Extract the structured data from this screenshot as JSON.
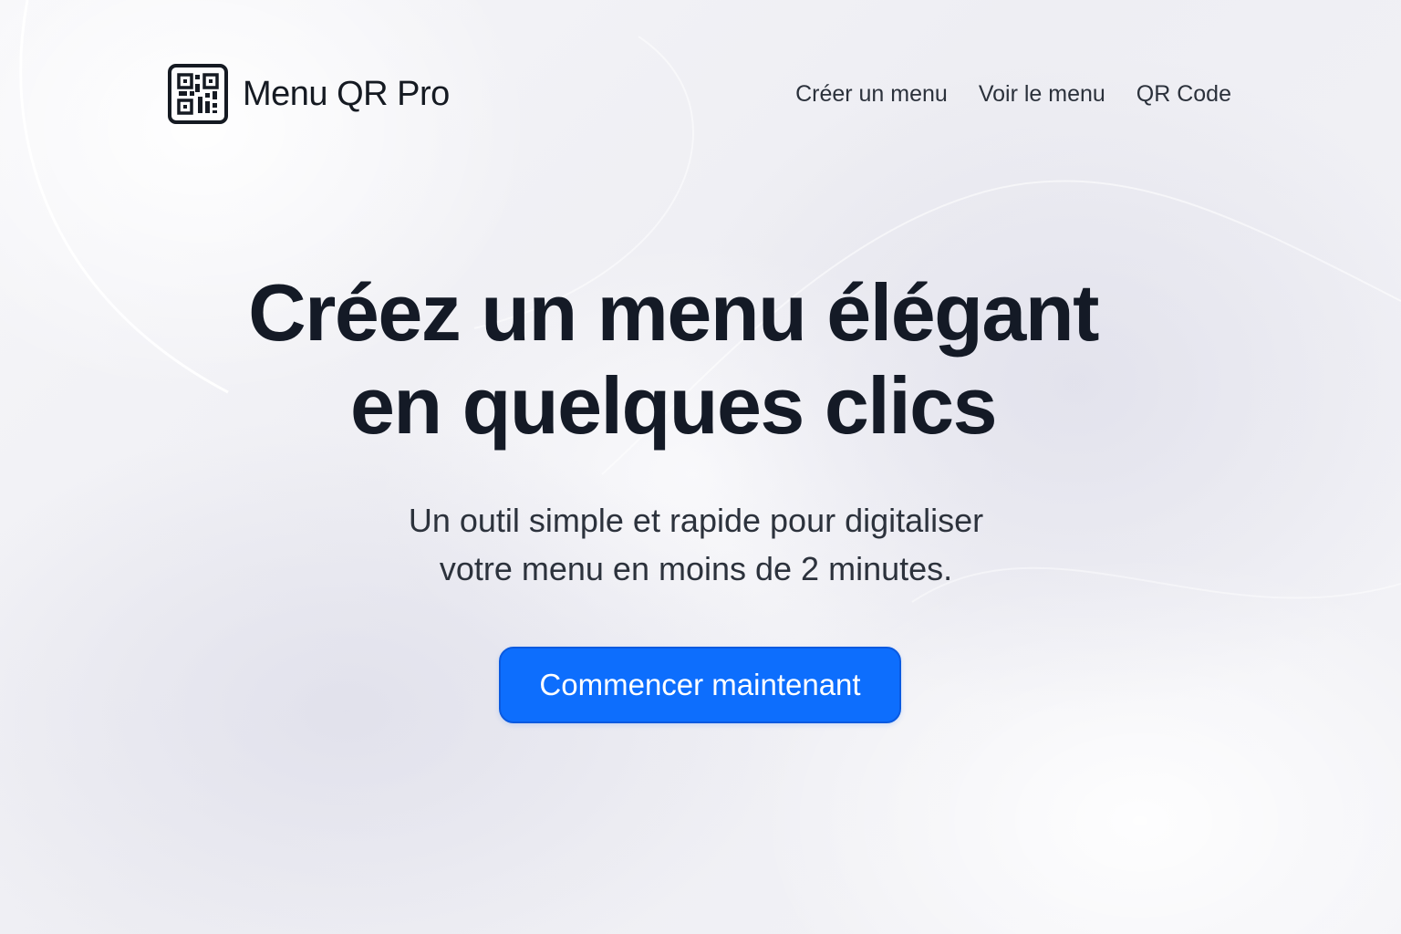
{
  "brand": {
    "name": "Menu QR Pro",
    "icon": "qr-code-icon"
  },
  "nav": {
    "items": [
      {
        "label": "Créer un menu"
      },
      {
        "label": "Voir le menu"
      },
      {
        "label": "QR Code"
      }
    ]
  },
  "hero": {
    "title_line1": "Créez un menu élégant",
    "title_line2": "en quelques clics",
    "subtitle_line1": "Un outil simple et rapide pour digitaliser",
    "subtitle_line2": "votre menu en moins de 2 minutes.",
    "cta_label": "Commencer maintenant"
  },
  "colors": {
    "accent": "#0d6efd",
    "text": "#141a26",
    "background": "#f1f1f5"
  }
}
